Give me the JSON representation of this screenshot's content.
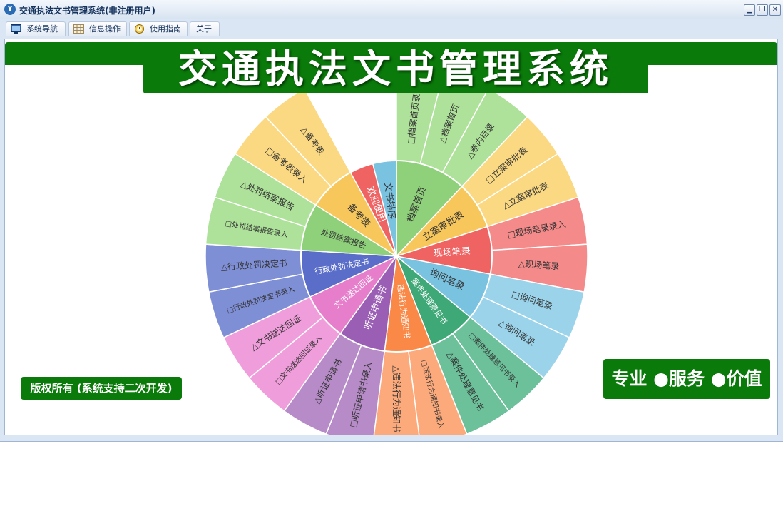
{
  "window": {
    "title": "交通执法文书管理系统(非注册用户)",
    "minimize": "▁",
    "restore": "❐",
    "close": "✕"
  },
  "tabs": [
    {
      "label": "系统导航",
      "icon": "monitor-icon"
    },
    {
      "label": "信息操作",
      "icon": "grid-icon"
    },
    {
      "label": "使用指南",
      "icon": "clock-icon"
    },
    {
      "label": "关于",
      "icon": ""
    }
  ],
  "banner": {
    "title": "交通执法文书管理系统"
  },
  "copyright": "版权所有 (系统支持二次开发)",
  "slogan": "专业 ●服务 ●价值",
  "chart_data": {
    "type": "sunburst",
    "categories": [
      {
        "name": "档案首页",
        "color": "#8fd17b",
        "outer_color": "#aee29a",
        "children": [
          "□档案首页录入",
          "△档案首页",
          "△卷内目录"
        ]
      },
      {
        "name": "立案审批表",
        "color": "#f7c75b",
        "outer_color": "#fbd983",
        "children": [
          "□立案审批表",
          "△立案审批表"
        ]
      },
      {
        "name": "现场笔录",
        "color": "#ef6363",
        "outer_color": "#f58a8a",
        "children": [
          "□现场笔录录入",
          "△现场笔录"
        ]
      },
      {
        "name": "询问笔录",
        "color": "#79c2e0",
        "outer_color": "#9bd4ea",
        "children": [
          "□询问笔录",
          "△询问笔录"
        ]
      },
      {
        "name": "案件处理意见书",
        "color": "#3fa877",
        "outer_color": "#6cc09a",
        "children": [
          "□案件处理意见书录入",
          "△案件处理意见书"
        ]
      },
      {
        "name": "违法行为通知书",
        "color": "#fa8846",
        "outer_color": "#fcaa7b",
        "children": [
          "□违法行为通知书录入",
          "△违法行为通知书"
        ]
      },
      {
        "name": "听证申请书",
        "color": "#9a5eb4",
        "outer_color": "#b68bc8",
        "children": [
          "□听证申请书录入",
          "△听证申请书"
        ]
      },
      {
        "name": "文书送达回证",
        "color": "#e67ecb",
        "outer_color": "#f09edb",
        "children": [
          "□文书送达回证录入",
          "△文书送达回证"
        ]
      },
      {
        "name": "行政处罚决定书",
        "color": "#5a6ec9",
        "outer_color": "#7f8fd6",
        "children": [
          "□行政处罚决定书录入",
          "△行政处罚决定书"
        ]
      },
      {
        "name": "处罚结案报告",
        "color": "#8fd17b",
        "outer_color": "#aee29a",
        "children": [
          "□处罚结案报告录入",
          "△处罚结案报告"
        ]
      },
      {
        "name": "备考表",
        "color": "#f7c75b",
        "outer_color": "#fbd983",
        "children": [
          "□备考表录入",
          "△备考表"
        ]
      },
      {
        "name": "欢迎使用",
        "color": "#ef6363",
        "outer_color": null,
        "children": []
      },
      {
        "name": "文书排序",
        "color": "#79c2e0",
        "outer_color": null,
        "children": []
      }
    ]
  }
}
